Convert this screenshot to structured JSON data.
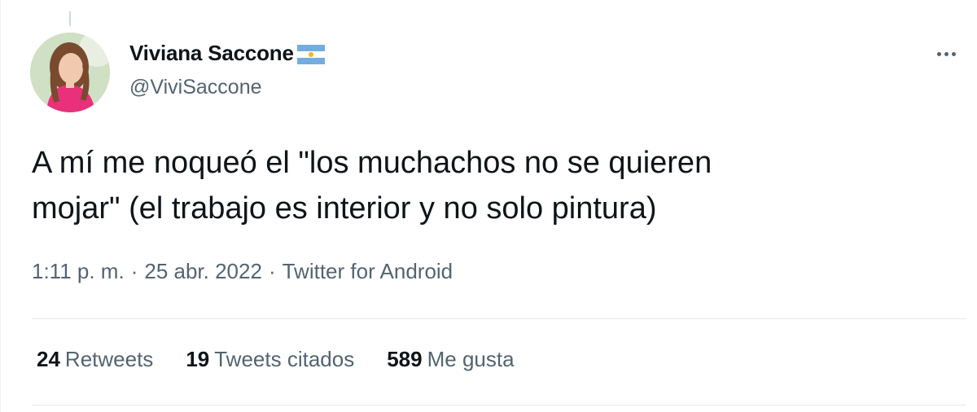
{
  "tweet": {
    "author": {
      "display_name": "Viviana Saccone",
      "handle": "@ViviSaccone",
      "flag": "argentina-flag"
    },
    "text": "A mí me noqueó el \"los muchachos no se quieren\nmojar\" (el trabajo es interior y no solo pintura)",
    "time": "1:11 p. m.",
    "separator1": "·",
    "date": "25 abr. 2022",
    "separator2": "·",
    "source": "Twitter for Android"
  },
  "stats": {
    "retweets_count": "24",
    "retweets_label": "Retweets",
    "quotes_count": "19",
    "quotes_label": "Tweets citados",
    "likes_count": "589",
    "likes_label": "Me gusta"
  },
  "colors": {
    "text_primary": "#0f1419",
    "text_secondary": "#536471",
    "divider": "#e3e8eb"
  }
}
